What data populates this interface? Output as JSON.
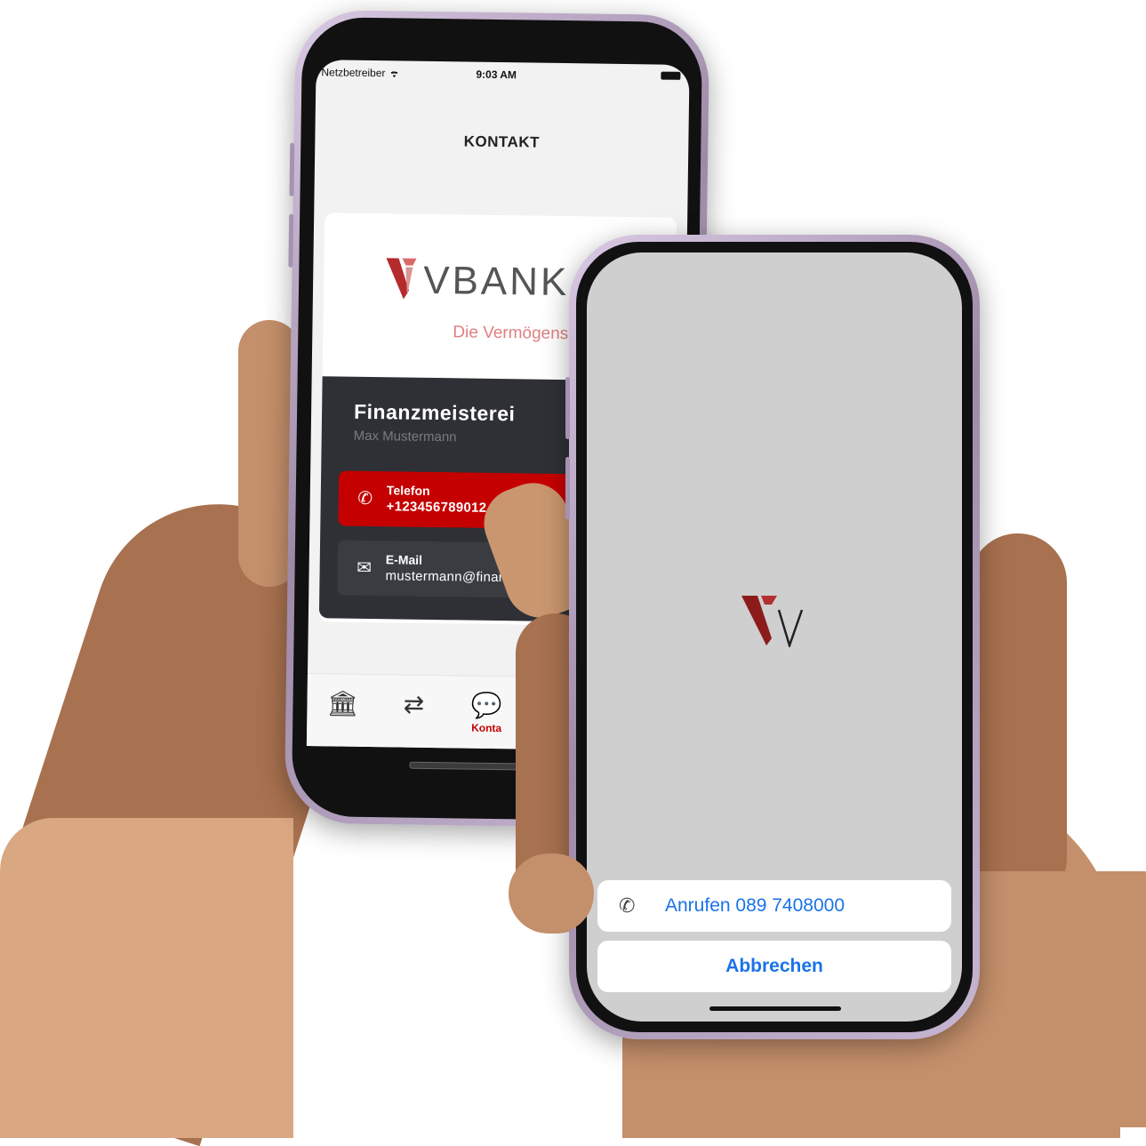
{
  "back_phone": {
    "status_bar": {
      "carrier": "Netzbetreiber",
      "time": "9:03 AM"
    },
    "title": "KONTAKT",
    "bank": {
      "name": "VBANK",
      "tagline": "Die Vermögens"
    },
    "contact": {
      "organization": "Finanzmeisterei",
      "person": "Max Mustermann",
      "phone_label": "Telefon",
      "phone_value": "+123456789012",
      "email_label": "E-Mail",
      "email_value": "mustermann@finan"
    },
    "tabs": [
      {
        "icon": "bank-icon",
        "label": ""
      },
      {
        "icon": "route-icon",
        "label": ""
      },
      {
        "icon": "contact-icon",
        "label": "Konta"
      }
    ],
    "accent_color": "#c50000"
  },
  "front_phone": {
    "call_action": {
      "icon": "phone-icon",
      "label": "Anrufen 089 7408000"
    },
    "cancel_label": "Abbrechen",
    "link_color": "#1a73e8"
  }
}
